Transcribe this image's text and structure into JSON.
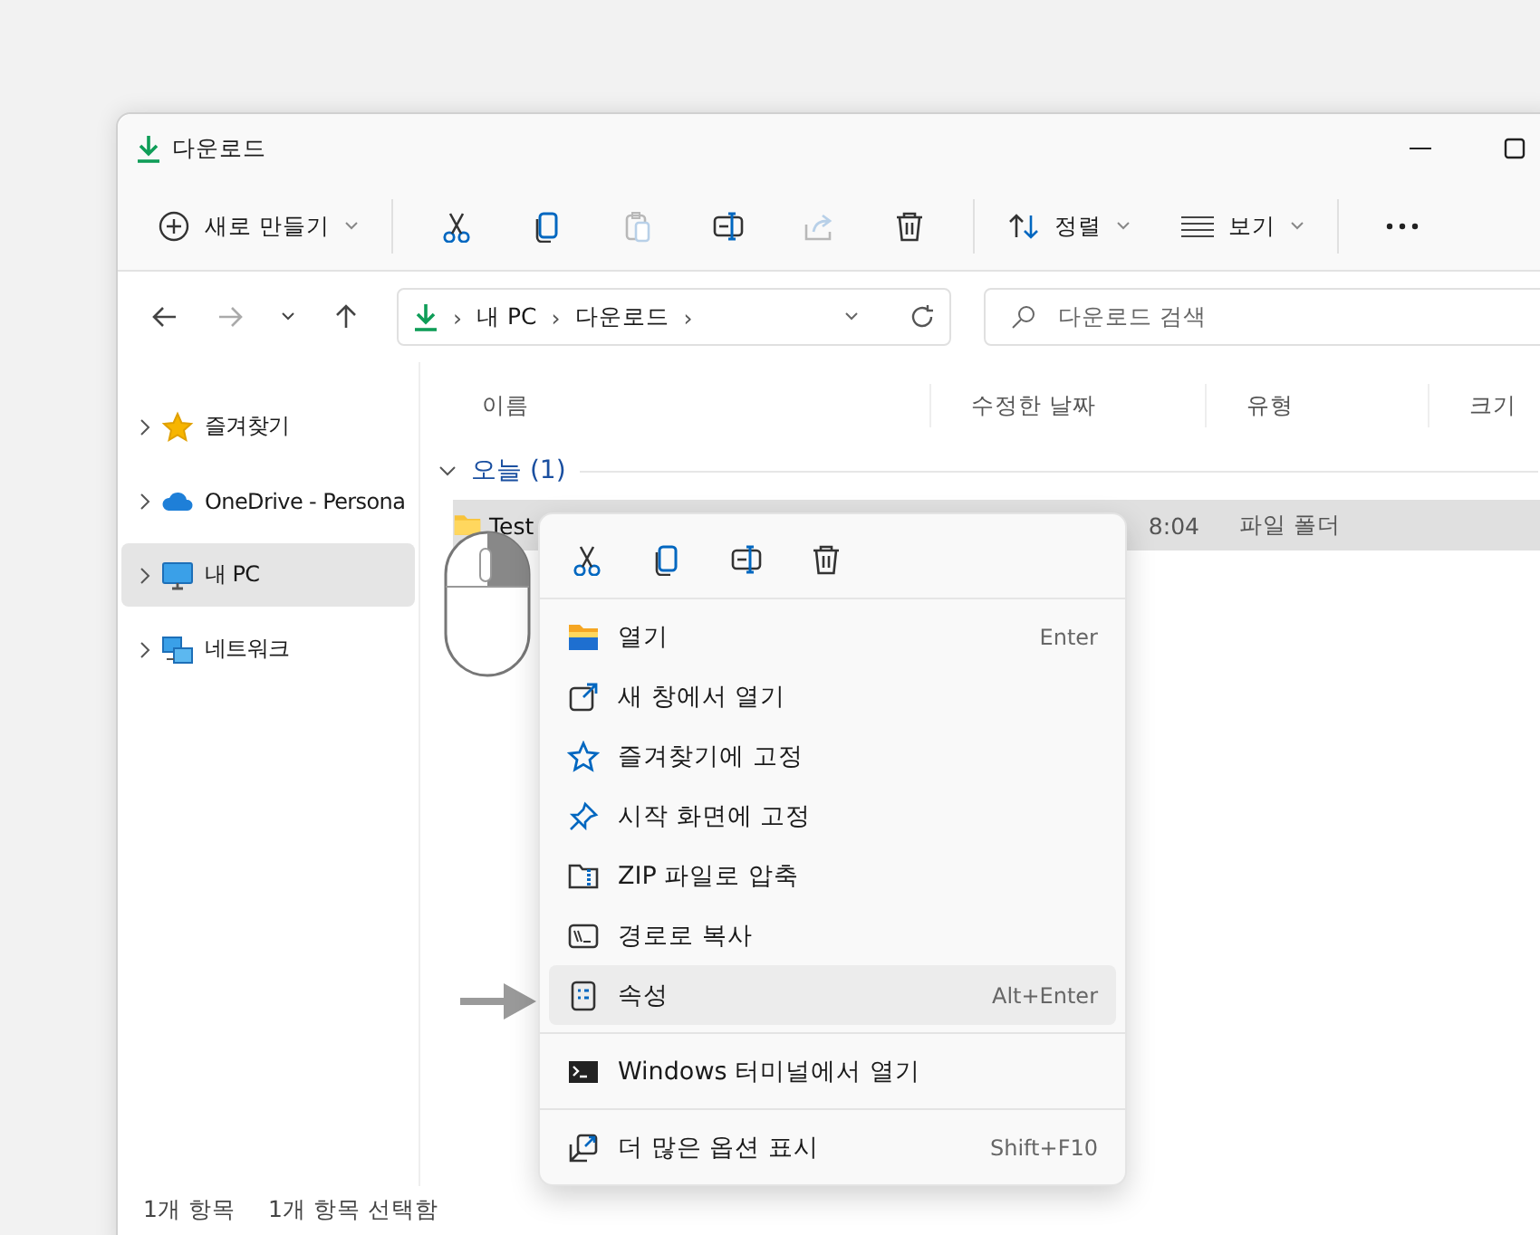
{
  "window": {
    "title": "다운로드"
  },
  "toolbar": {
    "new_button": {
      "label": "새로 만들기"
    },
    "actions": [
      {
        "kind": "cut",
        "disabled": false
      },
      {
        "kind": "copy",
        "disabled": false
      },
      {
        "kind": "paste",
        "disabled": true
      },
      {
        "kind": "rename",
        "disabled": false
      },
      {
        "kind": "share",
        "disabled": true
      },
      {
        "kind": "delete",
        "disabled": false
      }
    ],
    "sort": {
      "label": "정렬"
    },
    "view": {
      "label": "보기"
    }
  },
  "address": {
    "crumbs": [
      "내 PC",
      "다운로드"
    ],
    "separator": "›"
  },
  "search": {
    "placeholder": "다운로드 검색"
  },
  "sidebar": {
    "items": [
      {
        "label": "즐겨찾기",
        "kind": "star",
        "selected": false
      },
      {
        "label": "OneDrive - Persona",
        "kind": "cloud",
        "selected": false
      },
      {
        "label": "내 PC",
        "kind": "pc",
        "selected": true
      },
      {
        "label": "네트워크",
        "kind": "network",
        "selected": false
      }
    ]
  },
  "table": {
    "columns": [
      "이름",
      "수정한 날짜",
      "유형",
      "크기"
    ],
    "group": "오늘 (1)",
    "rows": [
      {
        "name": "Test",
        "date": "8:04",
        "type": "파일 폴더",
        "selected": true
      }
    ]
  },
  "context_menu": {
    "quick_actions": [
      {
        "kind": "cut"
      },
      {
        "kind": "copy"
      },
      {
        "kind": "rename"
      },
      {
        "kind": "delete"
      }
    ],
    "groups": [
      [
        {
          "kind": "open",
          "label": "열기",
          "shortcut": "Enter",
          "selected": false
        },
        {
          "kind": "new-window",
          "label": "새 창에서 열기",
          "selected": false
        },
        {
          "kind": "pin-favorite",
          "label": "즐겨찾기에 고정",
          "selected": false
        },
        {
          "kind": "pin-start",
          "label": "시작 화면에 고정",
          "selected": false
        },
        {
          "kind": "compress",
          "label": "ZIP 파일로 압축",
          "selected": false
        },
        {
          "kind": "copy-path",
          "label": "경로로 복사",
          "selected": false
        },
        {
          "kind": "properties",
          "label": "속성",
          "shortcut": "Alt+Enter",
          "selected": true
        }
      ],
      [
        {
          "kind": "terminal",
          "label": "Windows 터미널에서 열기",
          "selected": false
        }
      ],
      [
        {
          "kind": "more-options",
          "label": "더 많은 옵션 표시",
          "shortcut": "Shift+F10",
          "selected": false
        }
      ]
    ]
  },
  "status_bar": [
    "1개 항목",
    "1개 항목 선택함"
  ]
}
